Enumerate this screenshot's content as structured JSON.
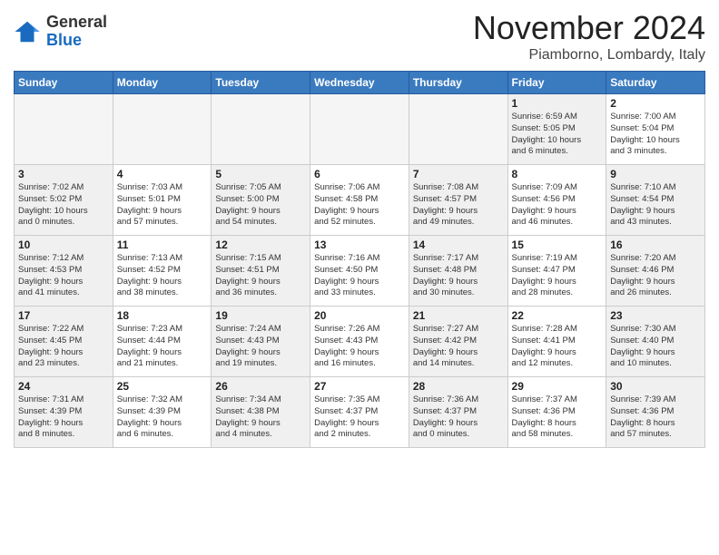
{
  "header": {
    "logo_general": "General",
    "logo_blue": "Blue",
    "title": "November 2024",
    "location": "Piamborno, Lombardy, Italy"
  },
  "weekdays": [
    "Sunday",
    "Monday",
    "Tuesday",
    "Wednesday",
    "Thursday",
    "Friday",
    "Saturday"
  ],
  "weeks": [
    [
      {
        "day": "",
        "info": "",
        "empty": true
      },
      {
        "day": "",
        "info": "",
        "empty": true
      },
      {
        "day": "",
        "info": "",
        "empty": true
      },
      {
        "day": "",
        "info": "",
        "empty": true
      },
      {
        "day": "",
        "info": "",
        "empty": true
      },
      {
        "day": "1",
        "info": "Sunrise: 6:59 AM\nSunset: 5:05 PM\nDaylight: 10 hours\nand 6 minutes.",
        "shaded": true
      },
      {
        "day": "2",
        "info": "Sunrise: 7:00 AM\nSunset: 5:04 PM\nDaylight: 10 hours\nand 3 minutes.",
        "shaded": false
      }
    ],
    [
      {
        "day": "3",
        "info": "Sunrise: 7:02 AM\nSunset: 5:02 PM\nDaylight: 10 hours\nand 0 minutes.",
        "shaded": true
      },
      {
        "day": "4",
        "info": "Sunrise: 7:03 AM\nSunset: 5:01 PM\nDaylight: 9 hours\nand 57 minutes.",
        "shaded": false
      },
      {
        "day": "5",
        "info": "Sunrise: 7:05 AM\nSunset: 5:00 PM\nDaylight: 9 hours\nand 54 minutes.",
        "shaded": true
      },
      {
        "day": "6",
        "info": "Sunrise: 7:06 AM\nSunset: 4:58 PM\nDaylight: 9 hours\nand 52 minutes.",
        "shaded": false
      },
      {
        "day": "7",
        "info": "Sunrise: 7:08 AM\nSunset: 4:57 PM\nDaylight: 9 hours\nand 49 minutes.",
        "shaded": true
      },
      {
        "day": "8",
        "info": "Sunrise: 7:09 AM\nSunset: 4:56 PM\nDaylight: 9 hours\nand 46 minutes.",
        "shaded": false
      },
      {
        "day": "9",
        "info": "Sunrise: 7:10 AM\nSunset: 4:54 PM\nDaylight: 9 hours\nand 43 minutes.",
        "shaded": true
      }
    ],
    [
      {
        "day": "10",
        "info": "Sunrise: 7:12 AM\nSunset: 4:53 PM\nDaylight: 9 hours\nand 41 minutes.",
        "shaded": true
      },
      {
        "day": "11",
        "info": "Sunrise: 7:13 AM\nSunset: 4:52 PM\nDaylight: 9 hours\nand 38 minutes.",
        "shaded": false
      },
      {
        "day": "12",
        "info": "Sunrise: 7:15 AM\nSunset: 4:51 PM\nDaylight: 9 hours\nand 36 minutes.",
        "shaded": true
      },
      {
        "day": "13",
        "info": "Sunrise: 7:16 AM\nSunset: 4:50 PM\nDaylight: 9 hours\nand 33 minutes.",
        "shaded": false
      },
      {
        "day": "14",
        "info": "Sunrise: 7:17 AM\nSunset: 4:48 PM\nDaylight: 9 hours\nand 30 minutes.",
        "shaded": true
      },
      {
        "day": "15",
        "info": "Sunrise: 7:19 AM\nSunset: 4:47 PM\nDaylight: 9 hours\nand 28 minutes.",
        "shaded": false
      },
      {
        "day": "16",
        "info": "Sunrise: 7:20 AM\nSunset: 4:46 PM\nDaylight: 9 hours\nand 26 minutes.",
        "shaded": true
      }
    ],
    [
      {
        "day": "17",
        "info": "Sunrise: 7:22 AM\nSunset: 4:45 PM\nDaylight: 9 hours\nand 23 minutes.",
        "shaded": true
      },
      {
        "day": "18",
        "info": "Sunrise: 7:23 AM\nSunset: 4:44 PM\nDaylight: 9 hours\nand 21 minutes.",
        "shaded": false
      },
      {
        "day": "19",
        "info": "Sunrise: 7:24 AM\nSunset: 4:43 PM\nDaylight: 9 hours\nand 19 minutes.",
        "shaded": true
      },
      {
        "day": "20",
        "info": "Sunrise: 7:26 AM\nSunset: 4:43 PM\nDaylight: 9 hours\nand 16 minutes.",
        "shaded": false
      },
      {
        "day": "21",
        "info": "Sunrise: 7:27 AM\nSunset: 4:42 PM\nDaylight: 9 hours\nand 14 minutes.",
        "shaded": true
      },
      {
        "day": "22",
        "info": "Sunrise: 7:28 AM\nSunset: 4:41 PM\nDaylight: 9 hours\nand 12 minutes.",
        "shaded": false
      },
      {
        "day": "23",
        "info": "Sunrise: 7:30 AM\nSunset: 4:40 PM\nDaylight: 9 hours\nand 10 minutes.",
        "shaded": true
      }
    ],
    [
      {
        "day": "24",
        "info": "Sunrise: 7:31 AM\nSunset: 4:39 PM\nDaylight: 9 hours\nand 8 minutes.",
        "shaded": true
      },
      {
        "day": "25",
        "info": "Sunrise: 7:32 AM\nSunset: 4:39 PM\nDaylight: 9 hours\nand 6 minutes.",
        "shaded": false
      },
      {
        "day": "26",
        "info": "Sunrise: 7:34 AM\nSunset: 4:38 PM\nDaylight: 9 hours\nand 4 minutes.",
        "shaded": true
      },
      {
        "day": "27",
        "info": "Sunrise: 7:35 AM\nSunset: 4:37 PM\nDaylight: 9 hours\nand 2 minutes.",
        "shaded": false
      },
      {
        "day": "28",
        "info": "Sunrise: 7:36 AM\nSunset: 4:37 PM\nDaylight: 9 hours\nand 0 minutes.",
        "shaded": true
      },
      {
        "day": "29",
        "info": "Sunrise: 7:37 AM\nSunset: 4:36 PM\nDaylight: 8 hours\nand 58 minutes.",
        "shaded": false
      },
      {
        "day": "30",
        "info": "Sunrise: 7:39 AM\nSunset: 4:36 PM\nDaylight: 8 hours\nand 57 minutes.",
        "shaded": true
      }
    ]
  ]
}
